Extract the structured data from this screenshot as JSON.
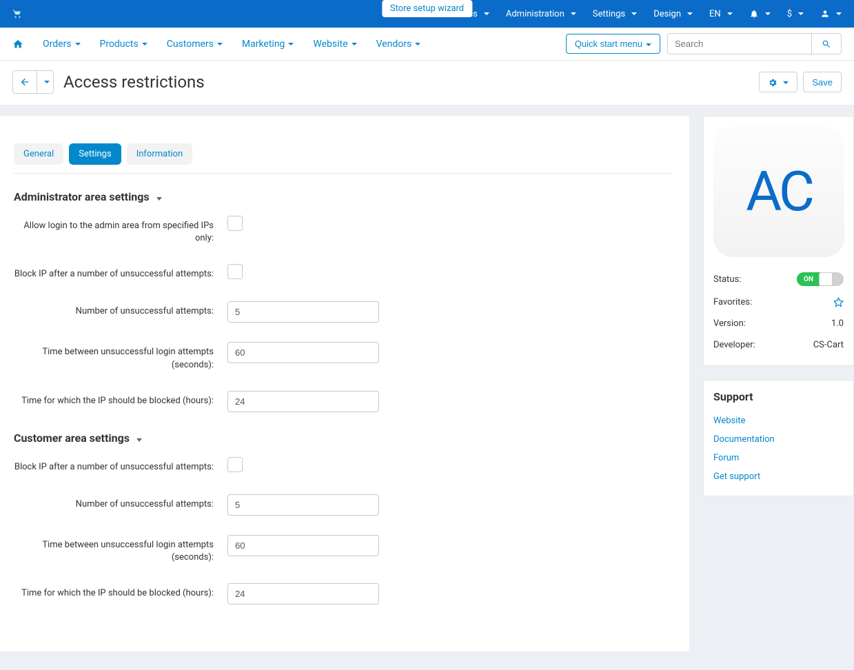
{
  "topbar": {
    "wizard": "Store setup wizard",
    "items": [
      "Add-ons",
      "Administration",
      "Settings",
      "Design"
    ],
    "lang": "EN",
    "currency": "$"
  },
  "nav": {
    "items": [
      "Orders",
      "Products",
      "Customers",
      "Marketing",
      "Website",
      "Vendors"
    ],
    "quickstart": "Quick start menu",
    "search_ph": "Search"
  },
  "title": "Access restrictions",
  "save": "Save",
  "tabs": {
    "general": "General",
    "settings": "Settings",
    "information": "Information"
  },
  "admin_section": {
    "title": "Administrator area settings",
    "allow_login": "Allow login to the admin area from specified IPs only:",
    "block_ip": "Block IP after a number of unsuccessful attempts:",
    "num_attempts_label": "Number of unsuccessful attempts:",
    "num_attempts": "5",
    "time_between_label": "Time between unsuccessful login attempts (seconds):",
    "time_between": "60",
    "block_hours_label": "Time for which the IP should be blocked (hours):",
    "block_hours": "24"
  },
  "cust_section": {
    "title": "Customer area settings",
    "block_ip": "Block IP after a number of unsuccessful attempts:",
    "num_attempts_label": "Number of unsuccessful attempts:",
    "num_attempts": "5",
    "time_between_label": "Time between unsuccessful login attempts (seconds):",
    "time_between": "60",
    "block_hours_label": "Time for which the IP should be blocked (hours):",
    "block_hours": "24"
  },
  "side": {
    "badge": "AC",
    "status_label": "Status:",
    "status_on": "ON",
    "fav_label": "Favorites:",
    "ver_label": "Version:",
    "ver": "1.0",
    "dev_label": "Developer:",
    "dev": "CS-Cart",
    "support_title": "Support",
    "links": {
      "website": "Website",
      "docs": "Documentation",
      "forum": "Forum",
      "support": "Get support"
    }
  }
}
